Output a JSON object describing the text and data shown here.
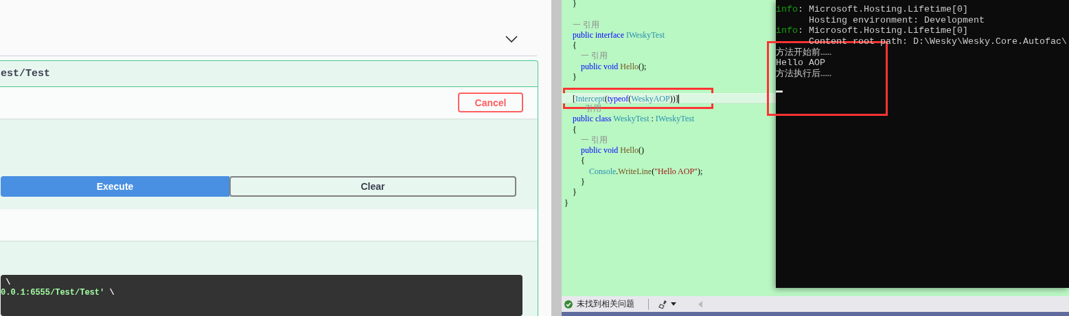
{
  "swagger_panel": {
    "operation": {
      "path": "est/Test",
      "cancel_button": "Cancel",
      "execute_button": "Execute",
      "clear_button": "Clear",
      "curl_lines": [
        [
          {
            "kind": "plain",
            "text": " \\"
          }
        ],
        [
          {
            "kind": "string",
            "text": "0.0.1:6555/Test/Test'"
          },
          {
            "kind": "plain",
            "text": " \\"
          }
        ]
      ]
    }
  },
  "code_editor": {
    "lines": [
      {
        "kind": "code",
        "current": false,
        "tokens": [
          {
            "kind": "plain",
            "text": "    }"
          }
        ]
      },
      {
        "kind": "blank"
      },
      {
        "kind": "lens",
        "tokens": [
          {
            "kind": "lens",
            "text": "    一 引用"
          }
        ]
      },
      {
        "kind": "code",
        "current": false,
        "tokens": [
          {
            "kind": "keyword",
            "text": "    public interface "
          },
          {
            "kind": "type",
            "text": "IWeskyTest"
          }
        ]
      },
      {
        "kind": "code",
        "current": false,
        "tokens": [
          {
            "kind": "plain",
            "text": "    {"
          }
        ]
      },
      {
        "kind": "lens",
        "tokens": [
          {
            "kind": "lens",
            "text": "        一 引用"
          }
        ]
      },
      {
        "kind": "code",
        "current": false,
        "tokens": [
          {
            "kind": "keyword",
            "text": "        public void "
          },
          {
            "kind": "method",
            "text": "Hello"
          },
          {
            "kind": "plain",
            "text": "();"
          }
        ]
      },
      {
        "kind": "code",
        "current": false,
        "tokens": [
          {
            "kind": "plain",
            "text": "    }"
          }
        ]
      },
      {
        "kind": "blank"
      },
      {
        "kind": "code",
        "current": true,
        "tokens": [
          {
            "kind": "plain",
            "text": "    ["
          },
          {
            "kind": "type",
            "text": "Intercept"
          },
          {
            "kind": "plain",
            "text": "("
          },
          {
            "kind": "keyword",
            "text": "typeof"
          },
          {
            "kind": "plain",
            "text": "("
          },
          {
            "kind": "type",
            "text": "WeskyAOP"
          },
          {
            "kind": "plain",
            "text": "))]"
          }
        ]
      },
      {
        "kind": "lens",
        "tokens": [
          {
            "kind": "lens",
            "text": "          引用"
          }
        ]
      },
      {
        "kind": "code",
        "current": false,
        "tokens": [
          {
            "kind": "keyword",
            "text": "    public class "
          },
          {
            "kind": "type",
            "text": "WeskyTest"
          },
          {
            "kind": "plain",
            "text": " : "
          },
          {
            "kind": "type",
            "text": "IWeskyTest"
          }
        ]
      },
      {
        "kind": "code",
        "current": false,
        "tokens": [
          {
            "kind": "plain",
            "text": "    {"
          }
        ]
      },
      {
        "kind": "lens",
        "tokens": [
          {
            "kind": "lens",
            "text": "        一 引用"
          }
        ]
      },
      {
        "kind": "code",
        "current": false,
        "tokens": [
          {
            "kind": "keyword",
            "text": "        public void "
          },
          {
            "kind": "method",
            "text": "Hello"
          },
          {
            "kind": "plain",
            "text": "()"
          }
        ]
      },
      {
        "kind": "code",
        "current": false,
        "tokens": [
          {
            "kind": "plain",
            "text": "        {"
          }
        ]
      },
      {
        "kind": "code",
        "current": false,
        "tokens": [
          {
            "kind": "type",
            "text": "            Console"
          },
          {
            "kind": "plain",
            "text": "."
          },
          {
            "kind": "method",
            "text": "WriteLine"
          },
          {
            "kind": "plain",
            "text": "("
          },
          {
            "kind": "string",
            "text": "\"Hello AOP\""
          },
          {
            "kind": "plain",
            "text": ");"
          }
        ]
      },
      {
        "kind": "code",
        "current": false,
        "tokens": [
          {
            "kind": "plain",
            "text": "        }"
          }
        ]
      },
      {
        "kind": "code",
        "current": false,
        "tokens": [
          {
            "kind": "plain",
            "text": "    }"
          }
        ]
      },
      {
        "kind": "code",
        "current": false,
        "tokens": [
          {
            "kind": "plain",
            "text": "}"
          }
        ]
      }
    ],
    "status_bar": {
      "issues_text": "未找到相关问题"
    }
  },
  "console": {
    "lines": [
      {
        "kind": "log",
        "level": "info",
        "text": ": Microsoft.Hosting.Lifetime[0]"
      },
      {
        "kind": "plain",
        "text": "      Hosting environment: Development"
      },
      {
        "kind": "log",
        "level": "info",
        "text": ": Microsoft.Hosting.Lifetime[0]"
      },
      {
        "kind": "plain",
        "text": "      Content root path: D:\\Wesky\\Wesky.Core.Autofac\\"
      },
      {
        "kind": "plain",
        "text": "方法开始前……"
      },
      {
        "kind": "plain",
        "text": "Hello AOP"
      },
      {
        "kind": "plain",
        "text": "方法执行后……"
      }
    ]
  }
}
